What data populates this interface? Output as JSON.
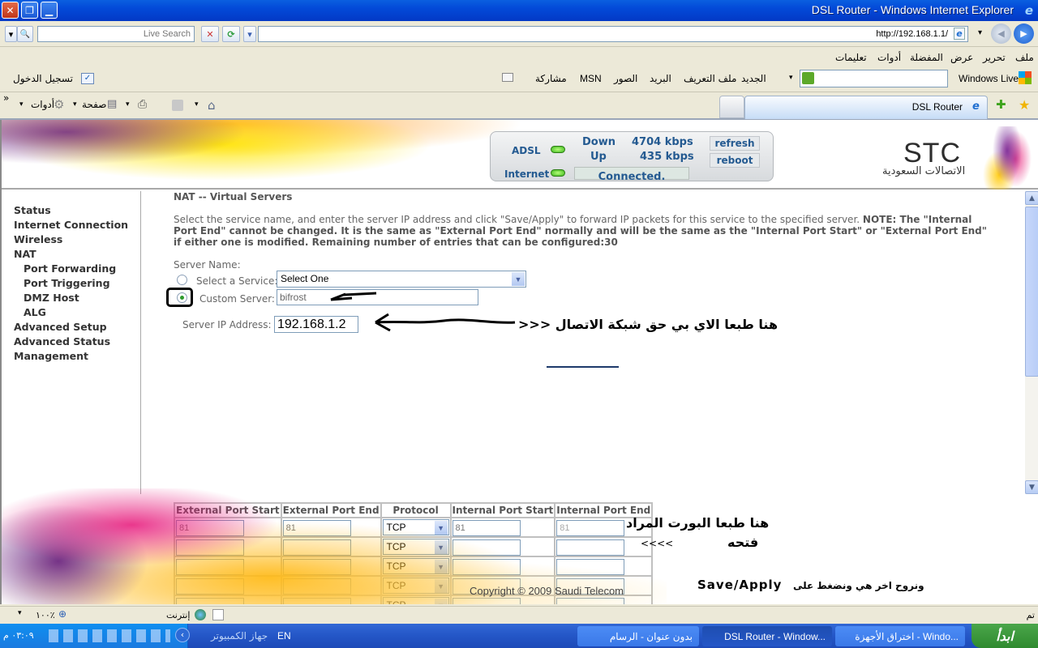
{
  "window": {
    "title": "DSL Router - Windows Internet Explorer",
    "close_glyph": "✕",
    "restore_glyph": "❐",
    "minimize_glyph": "▁",
    "ie_glyph": "e"
  },
  "toolbar": {
    "live_search_placeholder": "Live Search",
    "address": "http://192.168.1.1/",
    "stop_glyph": "✕",
    "refresh_glyph": "⟳",
    "dropdown_glyph": "▾",
    "search_glyph": "🔍",
    "back_glyph": "◀",
    "forward_glyph": "▶"
  },
  "menu": {
    "items": [
      "ملف",
      "تحرير",
      "عرض",
      "المفضلة",
      "أدوات",
      "تعليمات"
    ]
  },
  "windows_live": {
    "brand": "Windows Live",
    "links": [
      "الجديد",
      "ملف التعريف",
      "البريد",
      "الصور",
      "MSN",
      "مشاركة"
    ],
    "sign_in": "تسجيل الدخول"
  },
  "command_bar": {
    "tools_label": "أدوات",
    "page_label": "صفحة",
    "chevron": "»"
  },
  "tabs": [
    {
      "label": "DSL Router",
      "active": true
    }
  ],
  "router": {
    "status_panel": {
      "adsl_label": "ADSL",
      "internet_label": "Internet",
      "down_label": "Down",
      "down_value": "4704 kbps",
      "up_label": "Up",
      "up_value": "435 kbps",
      "connection_status": "Connected.",
      "refresh_button": "refresh",
      "reboot_button": "reboot"
    },
    "brand": {
      "logo": "STC",
      "arabic_name": "الاتصالات السعودية"
    },
    "sidebar": [
      {
        "label": "Status",
        "sub": false
      },
      {
        "label": "Internet Connection",
        "sub": false
      },
      {
        "label": "Wireless",
        "sub": false
      },
      {
        "label": "NAT",
        "sub": false
      },
      {
        "label": "Port Forwarding",
        "sub": true
      },
      {
        "label": "Port Triggering",
        "sub": true
      },
      {
        "label": "DMZ Host",
        "sub": true
      },
      {
        "label": "ALG",
        "sub": true
      },
      {
        "label": "Advanced Setup",
        "sub": false
      },
      {
        "label": "Advanced Status",
        "sub": false
      },
      {
        "label": "Management",
        "sub": false
      }
    ],
    "page_title": "NAT -- Virtual Servers",
    "description_normal": "Select the service name, and enter the server IP address and click \"Save/Apply\" to forward IP packets for this service to the specified server. ",
    "description_bold": "NOTE: The \"Internal Port End\" cannot be changed. It is the same as \"External Port End\" normally and will be the same as the \"Internal Port Start\" or \"External Port End\" if either one is modified. Remaining number of entries that can be configured:30",
    "form": {
      "server_name_label": "Server Name:",
      "select_service_label": "Select a Service:",
      "select_service_value": "Select One",
      "custom_server_label": "Custom Server:",
      "custom_server_value": "bifrost",
      "custom_server_selected": true,
      "server_ip_label": "Server IP Address:",
      "server_ip_value": "192.168.1.2"
    },
    "ports_table": {
      "headers": [
        "External Port Start",
        "External Port End",
        "Protocol",
        "Internal Port Start",
        "Internal Port End"
      ],
      "rows": [
        {
          "ext_start": "81",
          "ext_end": "81",
          "protocol": "TCP",
          "int_start": "81",
          "int_end": "81"
        },
        {
          "ext_start": "",
          "ext_end": "",
          "protocol": "TCP",
          "int_start": "",
          "int_end": ""
        },
        {
          "ext_start": "",
          "ext_end": "",
          "protocol": "TCP",
          "int_start": "",
          "int_end": ""
        },
        {
          "ext_start": "",
          "ext_end": "",
          "protocol": "TCP",
          "int_start": "",
          "int_end": ""
        },
        {
          "ext_start": "",
          "ext_end": "",
          "protocol": "TCP",
          "int_start": "",
          "int_end": ""
        }
      ]
    },
    "copyright": "Copyright © 2009 Saudi Telecom"
  },
  "annotations": {
    "ip_note": "هنا طبعا الاي بي حق شبكة الاتصال <<<",
    "port_note_line1": "هنا طبعا البورت المراد",
    "port_note_line2": "فتحه",
    "port_note_arrows": "<<<<",
    "save_note_arabic": "ونروح اخر هي ونضغط على",
    "save_note_button": "Save/Apply"
  },
  "statusbar": {
    "status_text": "تم",
    "zone": "إنترنت",
    "zoom": "١٠٠٪"
  },
  "taskbar": {
    "start_label": "ابدأ",
    "tasks": [
      {
        "label": "اختراق الأجهزة - Windo...",
        "active": false
      },
      {
        "label": "DSL Router - Window...",
        "active": true
      },
      {
        "label": "بدون عنوان - الرسام",
        "active": false
      }
    ],
    "language": "EN",
    "my_computer": "جهاز الكمبيوتر",
    "clock": "٠٣:٠٩ م"
  }
}
